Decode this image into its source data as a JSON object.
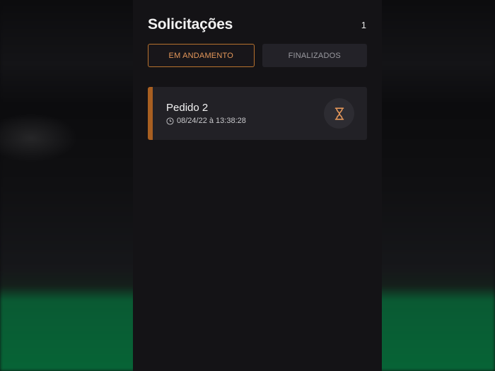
{
  "header": {
    "title": "Solicitações",
    "count": "1"
  },
  "tabs": [
    {
      "label": "EM ANDAMENTO",
      "active": true
    },
    {
      "label": "FINALIZADOS",
      "active": false
    }
  ],
  "requests": [
    {
      "title": "Pedido 2",
      "datetime": "08/24/22 à 13:38:28",
      "status_icon": "hourglass-icon"
    }
  ],
  "colors": {
    "accent": "#e4975a",
    "accent_bar": "#a85f21",
    "panel_bg": "#141316",
    "card_bg": "#222126"
  }
}
